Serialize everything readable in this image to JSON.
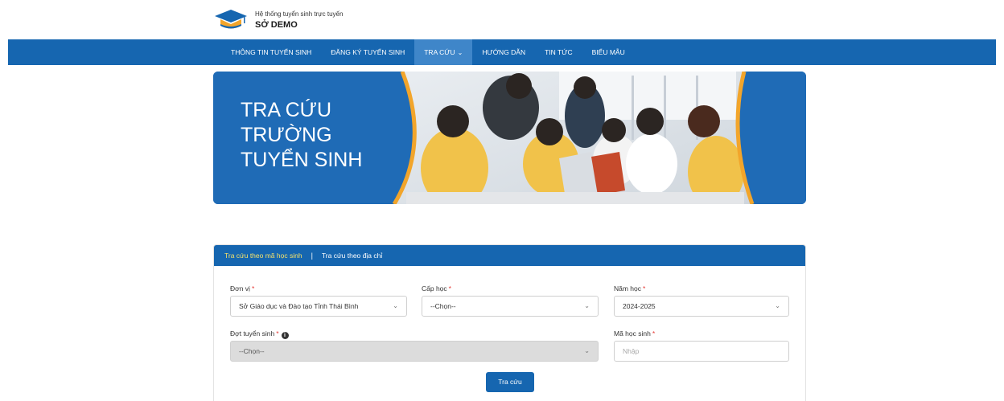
{
  "header": {
    "subtitle": "Hệ thống tuyển sinh trực tuyến",
    "title": "SỞ DEMO"
  },
  "nav": {
    "items": [
      {
        "label": "THÔNG TIN TUYỂN SINH"
      },
      {
        "label": "ĐĂNG KÝ TUYỂN SINH"
      },
      {
        "label": "TRA CỨU",
        "active": true
      },
      {
        "label": "HƯỚNG DẪN"
      },
      {
        "label": "TIN TỨC"
      },
      {
        "label": "BIỂU MẪU"
      }
    ]
  },
  "banner": {
    "line1": "TRA CỨU",
    "line2": "TRƯỜNG",
    "line3": "TUYỂN SINH"
  },
  "search": {
    "tabs": [
      {
        "label": "Tra cứu theo mã học sinh",
        "active": true
      },
      {
        "label": "Tra cứu theo địa chỉ"
      }
    ],
    "separator": "|",
    "fields": {
      "don_vi": {
        "label": "Đơn vị",
        "value": "Sở Giáo dục và Đào tạo Tỉnh Thái Bình"
      },
      "cap_hoc": {
        "label": "Cấp học",
        "value": "--Chọn--"
      },
      "nam_hoc": {
        "label": "Năm học",
        "value": "2024-2025"
      },
      "dot_tuyen_sinh": {
        "label": "Đợt tuyển sinh",
        "value": "--Chọn--"
      },
      "ma_hoc_sinh": {
        "label": "Mã học sinh",
        "placeholder": "Nhập"
      }
    },
    "required_mark": "*",
    "info_mark": "i",
    "submit_label": "Tra cứu"
  },
  "colors": {
    "primary": "#1666b0",
    "active_tab": "#f6e26a",
    "banner_accent": "#f2a52b",
    "required": "#e53935"
  }
}
